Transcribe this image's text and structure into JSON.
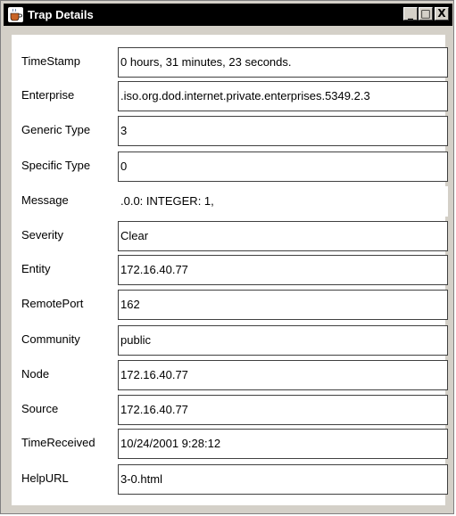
{
  "window": {
    "title": "Trap Details",
    "minimize_glyph": "_",
    "maximize_glyph": "□",
    "close_glyph": "X"
  },
  "fields": [
    {
      "label": "TimeStamp",
      "value": "0 hours, 31 minutes, 23 seconds."
    },
    {
      "label": "Enterprise",
      "value": ".iso.org.dod.internet.private.enterprises.5349.2.3"
    },
    {
      "label": "Generic Type",
      "value": "3"
    },
    {
      "label": "Specific Type",
      "value": "0"
    },
    {
      "label": "Message",
      "value": ".0.0: INTEGER: 1,"
    },
    {
      "label": "Severity",
      "value": "Clear"
    },
    {
      "label": "Entity",
      "value": "172.16.40.77"
    },
    {
      "label": "RemotePort",
      "value": "162"
    },
    {
      "label": "Community",
      "value": "public"
    },
    {
      "label": "Node",
      "value": "172.16.40.77"
    },
    {
      "label": "Source",
      "value": "172.16.40.77"
    },
    {
      "label": "TimeReceived",
      "value": "10/24/2001 9:28:12"
    },
    {
      "label": "HelpURL",
      "value": "3-0.html"
    }
  ]
}
